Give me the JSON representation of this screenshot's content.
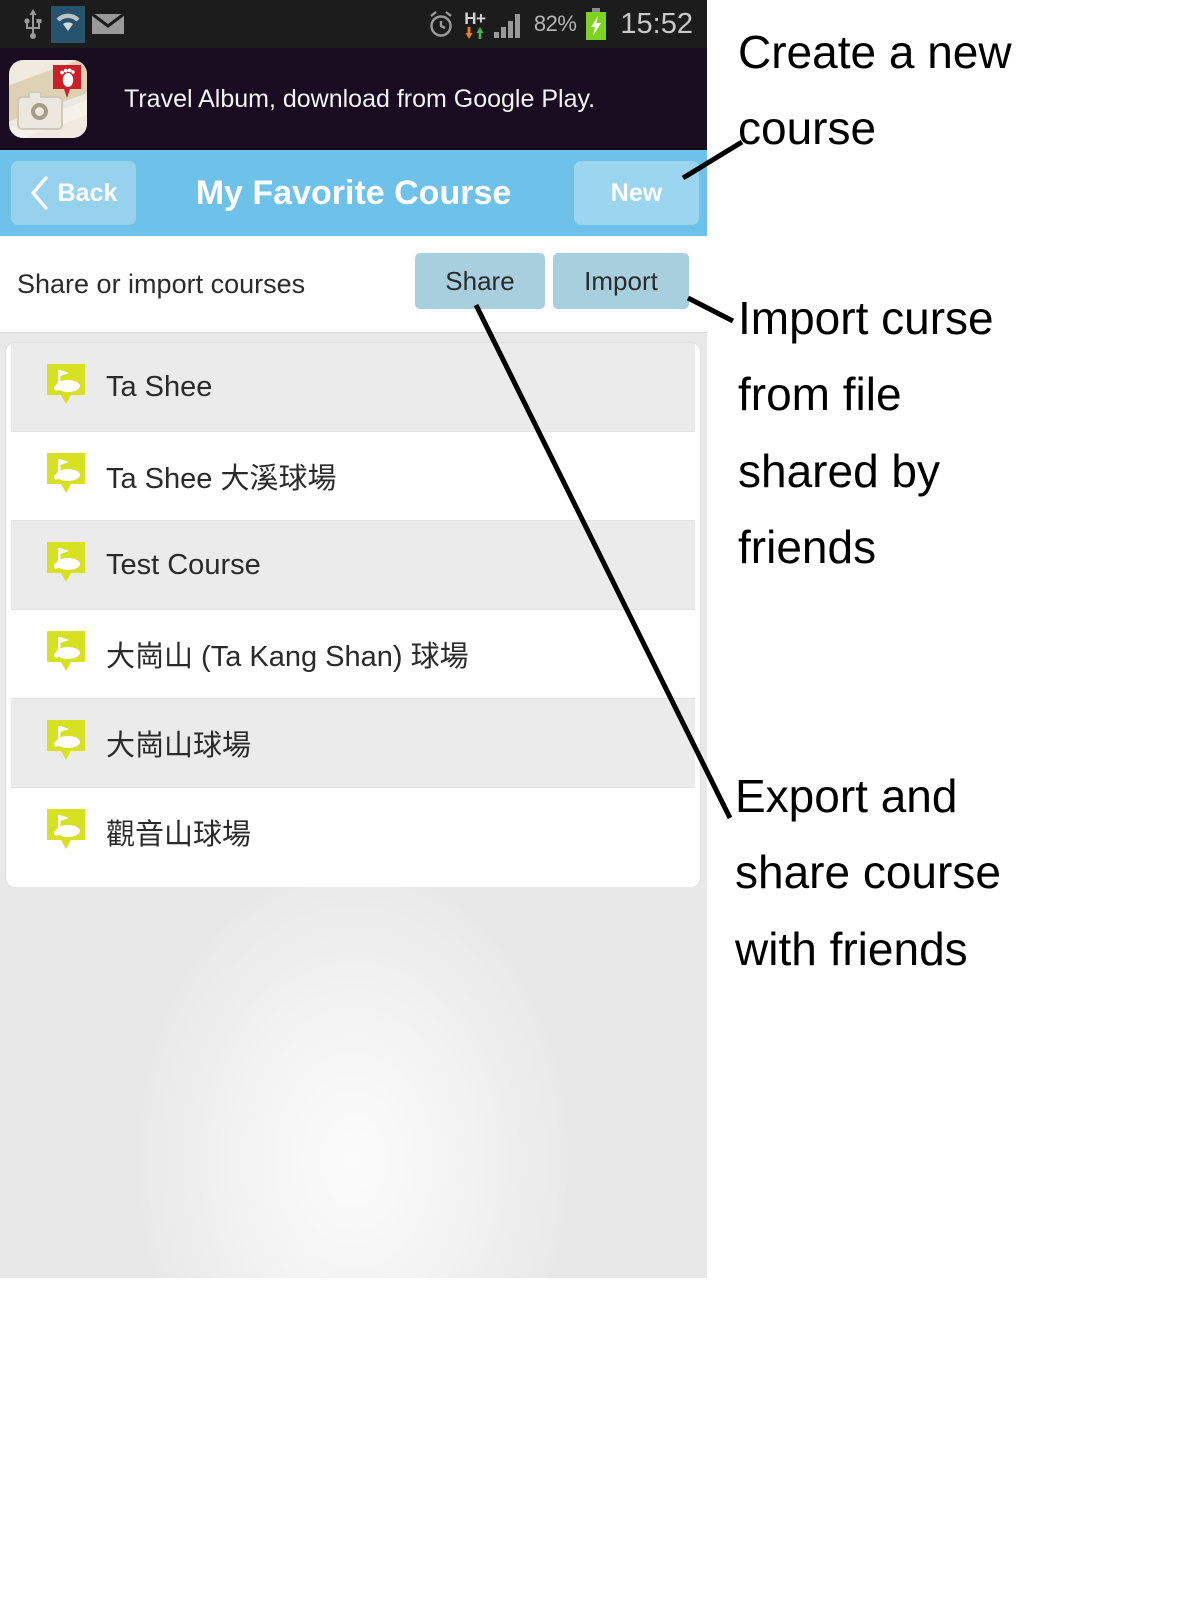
{
  "status_bar": {
    "icons": [
      "usb-icon",
      "wifi-icon",
      "mail-icon",
      "alarm-icon",
      "hspa-plus-icon",
      "signal-icon",
      "battery-charging-icon"
    ],
    "network_type": "H+",
    "battery_percent": "82%",
    "clock": "15:52"
  },
  "ad_banner": {
    "icon": "travel-album-app-icon",
    "text": "Travel Album, download from Google Play."
  },
  "title_bar": {
    "back_label": "Back",
    "back_icon": "chevron-left-icon",
    "title": "My Favorite Course",
    "new_label": "New"
  },
  "share_bar": {
    "label": "Share or import courses",
    "share_label": "Share",
    "import_label": "Import"
  },
  "course_list": {
    "item_icon": "golf-course-pin-icon",
    "items": [
      {
        "label": "Ta Shee"
      },
      {
        "label": "Ta Shee 大溪球場"
      },
      {
        "label": "Test Course"
      },
      {
        "label": "大崗山 (Ta Kang Shan) 球場"
      },
      {
        "label": "大崗山球場"
      },
      {
        "label": "觀音山球場"
      }
    ]
  },
  "annotations": {
    "new_button": "Create a new\ncourse",
    "import_button": "Import curse\nfrom file\nshared by\nfriends",
    "share_button": "Export and\nshare course\nwith friends"
  },
  "colors": {
    "title_bar_blue": "#6ec1e8",
    "button_blue": "#a7cfdd",
    "banner_dark": "#190b20",
    "status_bar_dark": "#1c1c1c",
    "pin_yellow": "#d7e021",
    "battery_green": "#7ed321",
    "row_alt_gray": "#ebebeb"
  }
}
